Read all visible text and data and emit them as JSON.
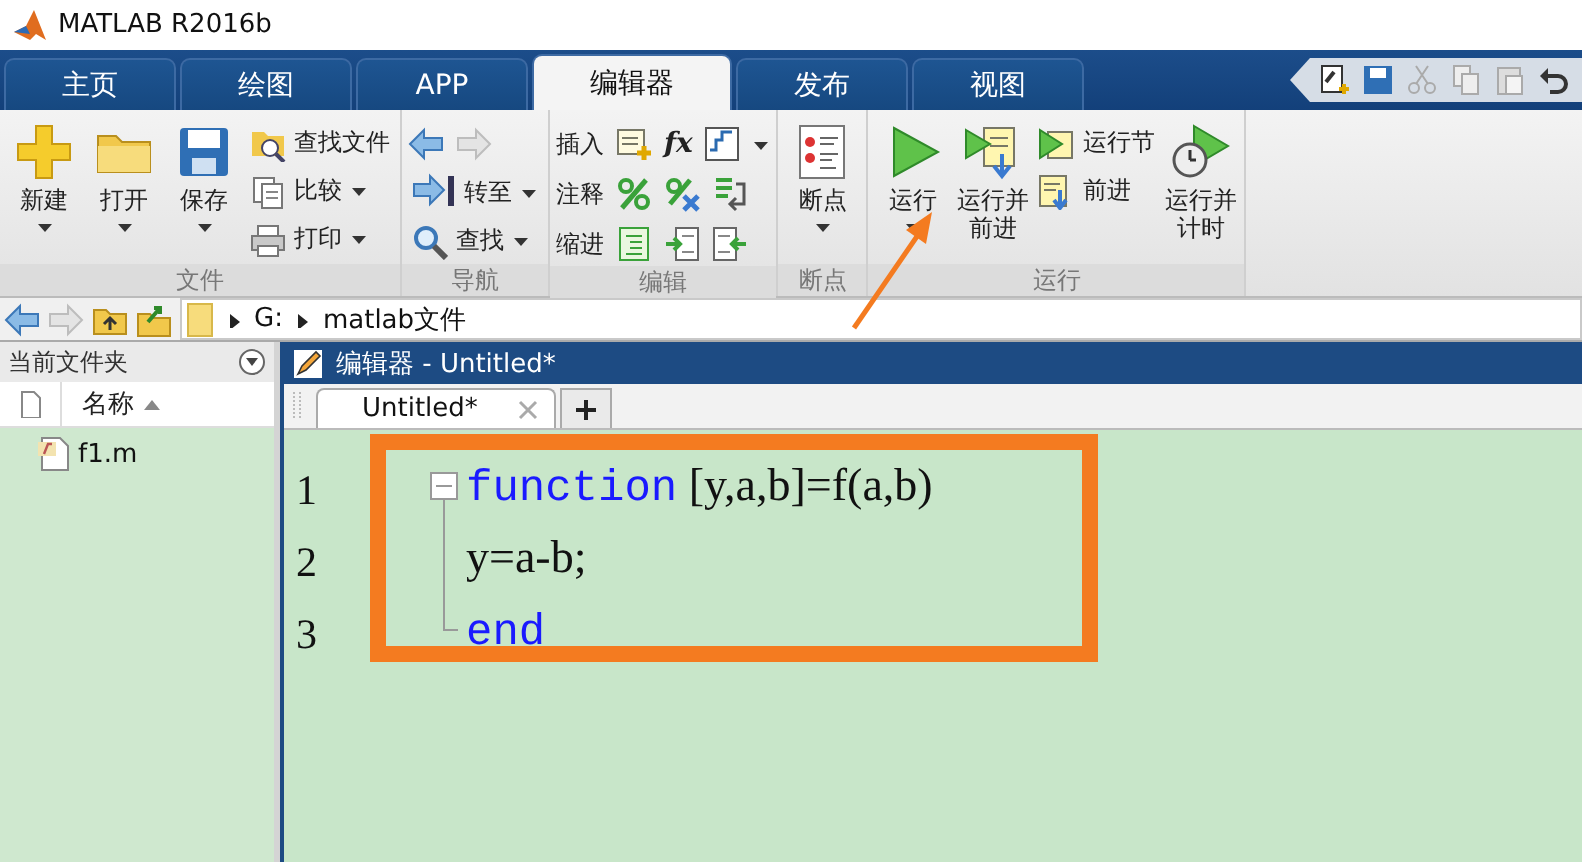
{
  "window": {
    "title": "MATLAB R2016b"
  },
  "tabs": [
    {
      "label": "主页",
      "selected": false
    },
    {
      "label": "绘图",
      "selected": false
    },
    {
      "label": "APP",
      "selected": false
    },
    {
      "label": "编辑器",
      "selected": true
    },
    {
      "label": "发布",
      "selected": false
    },
    {
      "label": "视图",
      "selected": false
    }
  ],
  "ribbon": {
    "groups": [
      {
        "label": "文件",
        "items": [
          {
            "kind": "large",
            "label": "新建",
            "dropdown": true
          },
          {
            "kind": "large",
            "label": "打开",
            "dropdown": true
          },
          {
            "kind": "large",
            "label": "保存",
            "dropdown": true
          },
          {
            "kind": "stack",
            "items": [
              {
                "label": "查找文件",
                "dropdown": false
              },
              {
                "label": "比较",
                "dropdown": true
              },
              {
                "label": "打印",
                "dropdown": true
              }
            ]
          }
        ]
      },
      {
        "label": "导航",
        "items": [
          {
            "kind": "stack",
            "items": [
              {
                "kind": "arrows"
              },
              {
                "label": "转至",
                "dropdown": true
              },
              {
                "label": "查找",
                "dropdown": true
              }
            ]
          }
        ]
      },
      {
        "label": "编辑",
        "items": [
          {
            "kind": "rows",
            "items": [
              {
                "label": "插入",
                "glyph": "fx",
                "dropdown": true
              },
              {
                "label": "注释",
                "dropdown": false
              },
              {
                "label": "缩进",
                "dropdown": false
              }
            ]
          }
        ]
      },
      {
        "label": "断点",
        "items": [
          {
            "kind": "large",
            "label": "断点",
            "dropdown": true
          }
        ]
      },
      {
        "label": "运行",
        "items": [
          {
            "kind": "large",
            "label": "运行",
            "dropdown": true
          },
          {
            "kind": "large",
            "label": "运行并前进",
            "dropdown": false
          },
          {
            "kind": "stack",
            "items": [
              {
                "label": "运行节",
                "dropdown": false
              },
              {
                "label": "前进",
                "dropdown": false
              }
            ]
          },
          {
            "kind": "large",
            "label": "运行并计时",
            "dropdown": false
          }
        ]
      }
    ]
  },
  "address": {
    "segments": [
      "G:",
      "matlab文件"
    ]
  },
  "files_panel": {
    "title": "当前文件夹",
    "column": "名称",
    "files": [
      {
        "name": "f1.m"
      }
    ]
  },
  "editor": {
    "title": "编辑器 - Untitled*",
    "tabs": [
      {
        "label": "Untitled*",
        "selected": true
      }
    ],
    "lines": [
      {
        "number": "1",
        "tokens": [
          {
            "text": "function",
            "kind": "keyword"
          },
          {
            "text": " [y,a,b]=f(a,b)",
            "kind": "plain"
          }
        ]
      },
      {
        "number": "2",
        "tokens": [
          {
            "text": "y=a-b;",
            "kind": "plain"
          }
        ]
      },
      {
        "number": "3",
        "tokens": [
          {
            "text": "end",
            "kind": "keyword"
          }
        ]
      }
    ]
  }
}
